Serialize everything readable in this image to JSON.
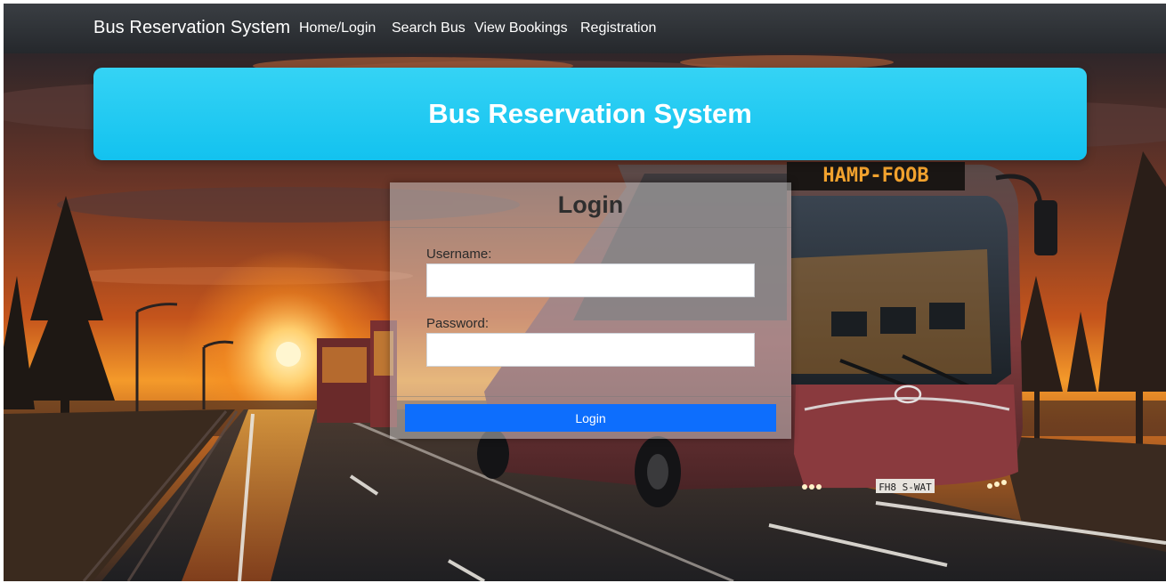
{
  "navbar": {
    "brand": "Bus Reservation System",
    "links": [
      {
        "label": "Home/Login"
      },
      {
        "label": "Search Bus"
      },
      {
        "label": "View Bookings"
      },
      {
        "label": "Registration"
      }
    ]
  },
  "hero": {
    "title": "Bus Reservation System"
  },
  "login": {
    "title": "Login",
    "username_label": "Username:",
    "username_value": "",
    "password_label": "Password:",
    "password_value": "",
    "submit_label": "Login"
  },
  "background": {
    "bus_sign": "HAMP-FOOB",
    "license_plate": "FH8 S-WAT",
    "colors": {
      "sky_top": "#3a2a2e",
      "sky_glow": "#f58a1f",
      "sun": "#ffe08a",
      "bus_body": "#7e3a3c",
      "road": "#2a2a2e"
    }
  },
  "colors": {
    "navbar": "#2f3236",
    "hero": "#1ecbf2",
    "primary_button": "#0d6efd"
  }
}
